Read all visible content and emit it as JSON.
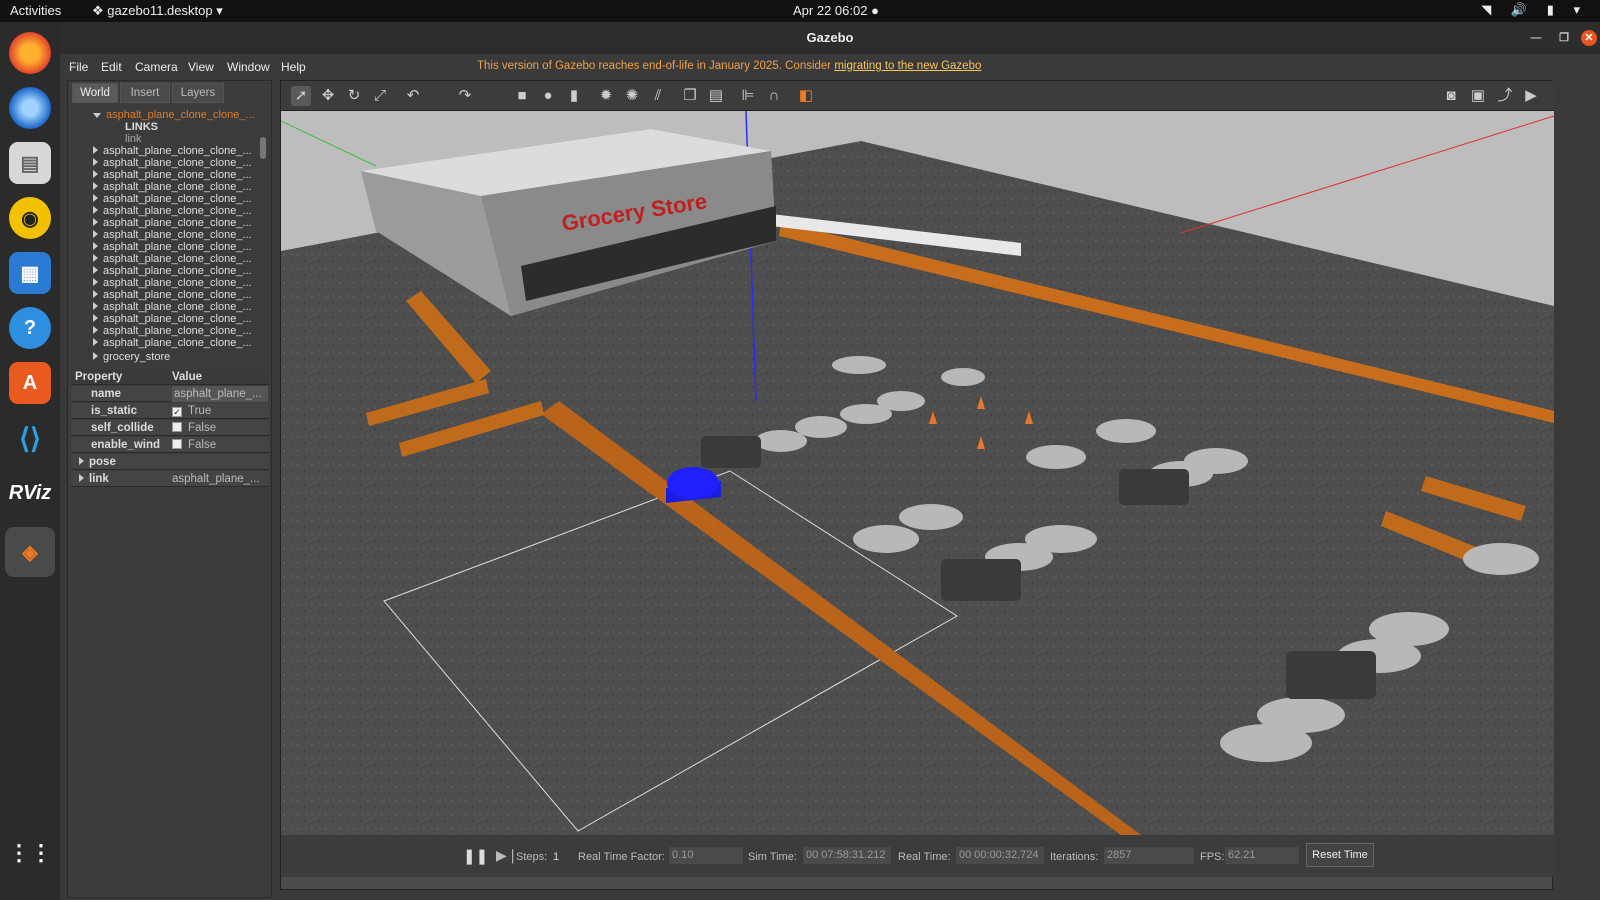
{
  "topbar": {
    "activities": "Activities",
    "app": "gazebo11.desktop",
    "clock": "Apr 22  06:02"
  },
  "window": {
    "title": "Gazebo"
  },
  "menu": {
    "items": [
      "File",
      "Edit",
      "Camera",
      "View",
      "Window",
      "Help"
    ],
    "eol_text": "This version of Gazebo reaches end-of-life in January 2025. Consider ",
    "eol_link": "migrating to the new Gazebo"
  },
  "tabs": [
    "World",
    "Insert",
    "Layers"
  ],
  "tree": {
    "selected": "asphalt_plane_clone_clone_...",
    "links_header": "LINKS",
    "link_item": "link",
    "items": [
      "asphalt_plane_clone_clone_...",
      "asphalt_plane_clone_clone_...",
      "asphalt_plane_clone_clone_...",
      "asphalt_plane_clone_clone_...",
      "asphalt_plane_clone_clone_...",
      "asphalt_plane_clone_clone_...",
      "asphalt_plane_clone_clone_...",
      "asphalt_plane_clone_clone_...",
      "asphalt_plane_clone_clone_...",
      "asphalt_plane_clone_clone_...",
      "asphalt_plane_clone_clone_...",
      "asphalt_plane_clone_clone_...",
      "asphalt_plane_clone_clone_...",
      "asphalt_plane_clone_clone_...",
      "asphalt_plane_clone_clone_...",
      "asphalt_plane_clone_clone_...",
      "asphalt_plane_clone_clone_..."
    ],
    "last": "grocery_store"
  },
  "props": {
    "h_property": "Property",
    "h_value": "Value",
    "name_k": "name",
    "name_v": "asphalt_plane_...",
    "static_k": "is_static",
    "static_v": "True",
    "collide_k": "self_collide",
    "collide_v": "False",
    "wind_k": "enable_wind",
    "wind_v": "False",
    "pose_k": "pose",
    "link_k": "link",
    "link_v": "asphalt_plane_..."
  },
  "scene": {
    "store_sign": "Grocery Store"
  },
  "bottom": {
    "steps_label": "Steps:",
    "steps_value": "1",
    "rtf_label": "Real Time Factor:",
    "rtf_value": "0.10",
    "sim_label": "Sim Time:",
    "sim_value": "00 07:58:31.212",
    "real_label": "Real Time:",
    "real_value": "00 00:00:32.724",
    "iter_label": "Iterations:",
    "iter_value": "2857",
    "fps_label": "FPS:",
    "fps_value": "62.21",
    "reset": "Reset Time"
  },
  "dock": {
    "rviz": "RViz"
  }
}
